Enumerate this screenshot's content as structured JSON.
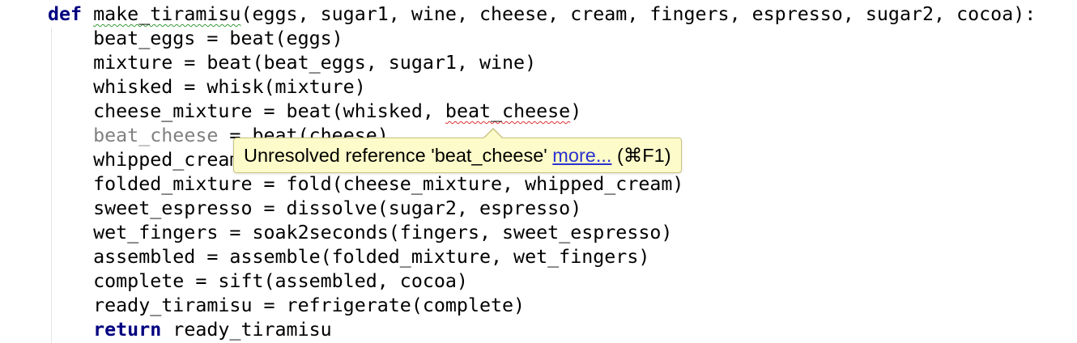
{
  "code": {
    "line1": {
      "keyword": "def",
      "sp": " ",
      "func_name": "make_tiramisu",
      "rest": "(eggs, sugar1, wine, cheese, cream, fingers, espresso, sugar2, cocoa):"
    },
    "line2": "    beat_eggs = beat(eggs)",
    "line3": "    mixture = beat(beat_eggs, sugar1, wine)",
    "line4": "    whisked = whisk(mixture)",
    "line5": {
      "before": "    cheese_mixture = beat(whisked, ",
      "unresolved": "beat_cheese",
      "after": ")"
    },
    "line6": {
      "indent": "    ",
      "unused_var": "beat_cheese",
      "rest": " = beat(cheese)"
    },
    "line7": "    whipped_cream = whip(cream)",
    "line8": "    folded_mixture = fold(cheese_mixture, whipped_cream)",
    "line9": "    sweet_espresso = dissolve(sugar2, espresso)",
    "line10": "    wet_fingers = soak2seconds(fingers, sweet_espresso)",
    "line11": "    assembled = assemble(folded_mixture, wet_fingers)",
    "line12": "    complete = sift(assembled, cocoa)",
    "line13": "    ready_tiramisu = refrigerate(complete)",
    "line14": {
      "indent": "    ",
      "keyword": "return",
      "rest": " ready_tiramisu"
    }
  },
  "tooltip": {
    "message": "Unresolved reference 'beat_cheese'",
    "link": "more...",
    "shortcut": "(⌘F1)"
  },
  "colors": {
    "keyword": "#000080",
    "unused": "#808080",
    "error_underline": "#e03030",
    "weak_warning_underline": "#3a9a3a",
    "tooltip_background": "#fdfbc9",
    "link": "#2a31d0"
  }
}
